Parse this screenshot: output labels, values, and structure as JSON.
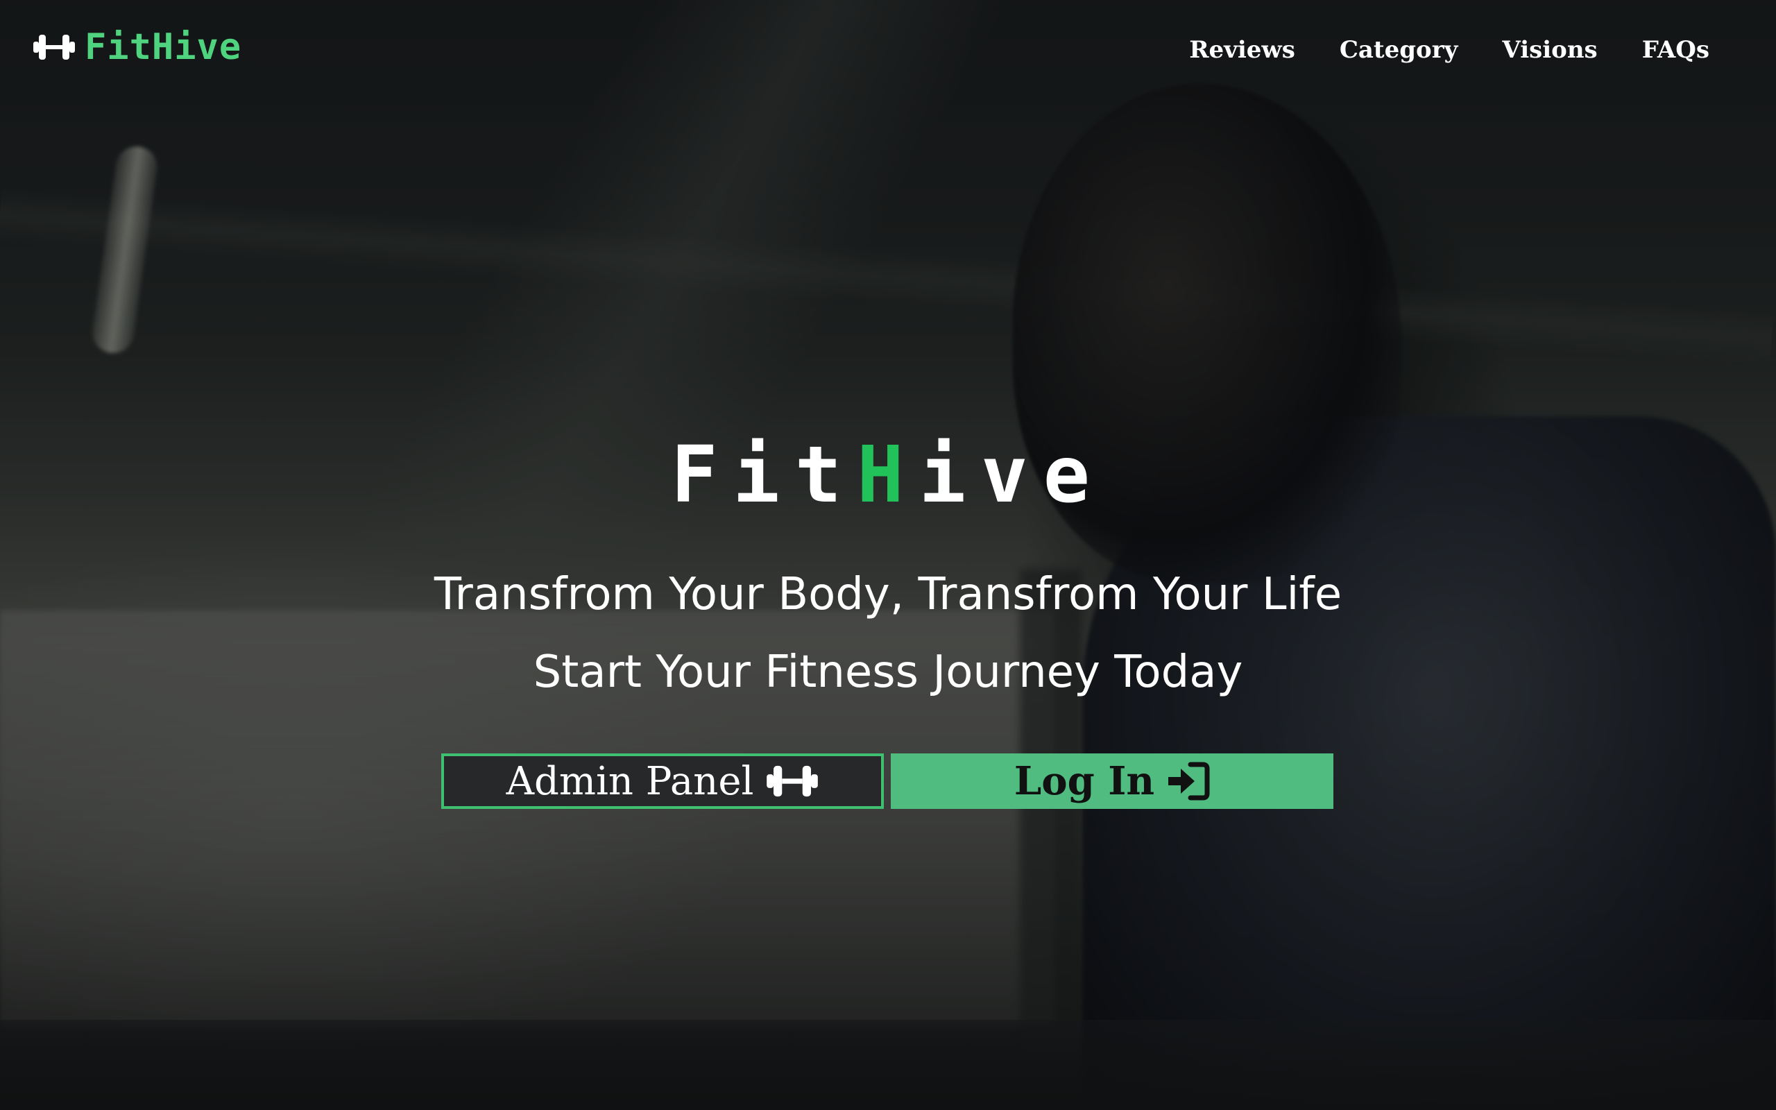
{
  "header": {
    "brand": "FitHive",
    "brand_icon": "dumbbell-icon",
    "nav": [
      {
        "label": "Reviews"
      },
      {
        "label": "Category"
      },
      {
        "label": "Visions"
      },
      {
        "label": "FAQs"
      }
    ]
  },
  "hero": {
    "title_part1": "Fit",
    "title_accent": "H",
    "title_part2": "ive",
    "tagline_1": "Transfrom Your Body, Transfrom Your Life",
    "tagline_2": "Start Your Fitness Journey Today"
  },
  "buttons": {
    "admin_label": "Admin Panel",
    "admin_icon": "dumbbell-icon",
    "login_label": "Log In",
    "login_icon": "sign-in-icon"
  },
  "colors": {
    "accent": "#4fd37e",
    "title_accent": "#22c25a",
    "login_bg": "#50bc80"
  }
}
